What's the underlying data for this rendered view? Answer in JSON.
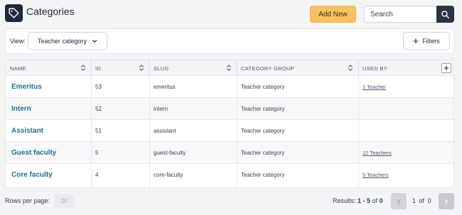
{
  "header": {
    "title": "Categories",
    "add_label": "Add New",
    "search_placeholder": "Search"
  },
  "toolbar": {
    "view_label": "View:",
    "view_value": "Teacher category",
    "filters_label": "Filters"
  },
  "table": {
    "columns": [
      "NAME",
      "ID",
      "SLUG",
      "CATEGORY GROUP",
      "USED BY"
    ],
    "rows": [
      {
        "name": "Emeritus",
        "id": "53",
        "slug": "emeritus",
        "group": "Teacher category",
        "used_by": "1 Teacher"
      },
      {
        "name": "Intern",
        "id": "52",
        "slug": "intern",
        "group": "Teacher category",
        "used_by": ""
      },
      {
        "name": "Assistant",
        "id": "51",
        "slug": "assistant",
        "group": "Teacher category",
        "used_by": ""
      },
      {
        "name": "Guest faculty",
        "id": "5",
        "slug": "guest-faculty",
        "group": "Teacher category",
        "used_by": "12 Teachers"
      },
      {
        "name": "Core faculty",
        "id": "4",
        "slug": "core-faculty",
        "group": "Teacher category",
        "used_by": "5 Teachers"
      }
    ]
  },
  "footer": {
    "rows_per_page_label": "Rows per page:",
    "rows_per_page_value": "20",
    "results_prefix": "Results:",
    "results_range": "1 - 5",
    "results_of": "of",
    "results_total": "0",
    "page_current": "1",
    "page_of": "of",
    "page_total": "0"
  },
  "icons": {
    "app": "tag-icon",
    "search": "search-icon",
    "filters": "plus-icon",
    "sort": "sort-icon",
    "add_column": "plus-icon",
    "prev": "chevron-left-icon",
    "next": "chevron-right-icon"
  },
  "colors": {
    "accent": "#f8c262",
    "link": "#1f6f96",
    "dark": "#1f2937"
  }
}
